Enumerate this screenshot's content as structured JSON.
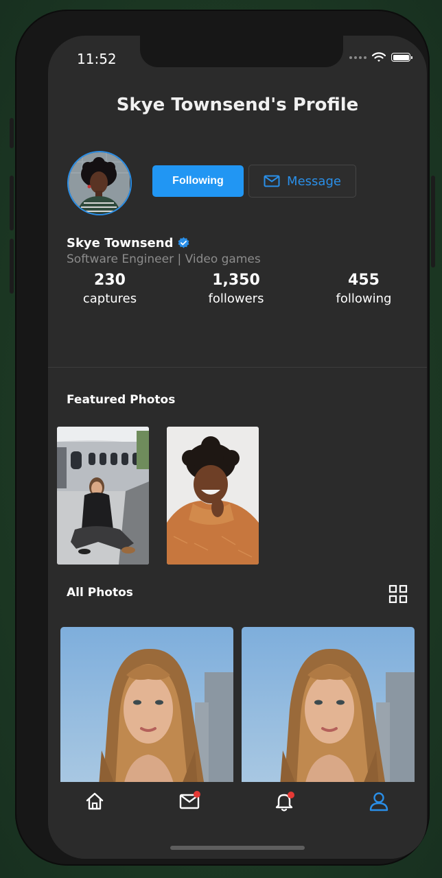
{
  "status_bar": {
    "time": "11:52"
  },
  "header": {
    "title": "Skye Townsend's Profile"
  },
  "profile": {
    "name": "Skye Townsend",
    "bio": "Software Engineer | Video games",
    "verified": true,
    "actions": {
      "following_label": "Following",
      "message_label": "Message"
    },
    "stats": [
      {
        "value": "230",
        "label": "captures"
      },
      {
        "value": "1,350",
        "label": "followers"
      },
      {
        "value": "455",
        "label": "following"
      }
    ]
  },
  "featured": {
    "title": "Featured Photos"
  },
  "all_photos": {
    "title": "All Photos"
  },
  "tabbar": {
    "items": [
      "home-icon",
      "mail-icon",
      "bell-icon",
      "user-icon"
    ],
    "active": "user-icon"
  },
  "colors": {
    "accent": "#2196f3",
    "badge": "#e53935",
    "background": "#2b2b2b"
  }
}
